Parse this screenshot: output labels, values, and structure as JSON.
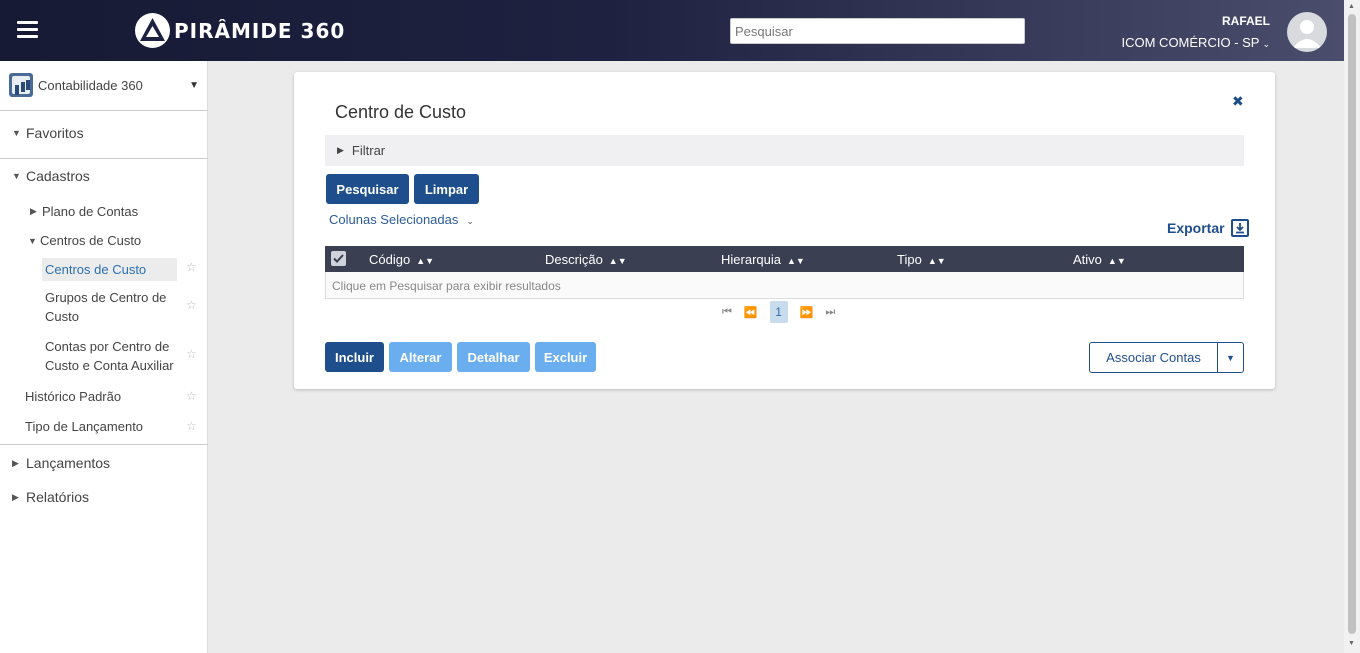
{
  "header": {
    "brand": "PIRÂMIDE 360",
    "search_placeholder": "Pesquisar",
    "user_name": "RAFAEL",
    "company": "ICOM COMÉRCIO - SP"
  },
  "sidebar": {
    "module": "Contabilidade 360",
    "favoritos": "Favoritos",
    "cadastros": "Cadastros",
    "plano_contas": "Plano de Contas",
    "centros_custo_group": "Centros de Custo",
    "centros_custo": "Centros de Custo",
    "grupos_centro_line1": "Grupos de Centro de",
    "grupos_centro_line2": "Custo",
    "contas_por_line1": "Contas por Centro de",
    "contas_por_line2": "Custo e Conta Auxiliar",
    "historico": "Histórico Padrão",
    "tipo_lancamento": "Tipo de Lançamento",
    "lancamentos": "Lançamentos",
    "relatorios": "Relatórios"
  },
  "main": {
    "title": "Centro de Custo",
    "filter": "Filtrar",
    "search_button": "Pesquisar",
    "clear_button": "Limpar",
    "selected_columns": "Colunas Selecionadas",
    "export": "Exportar",
    "columns": [
      "Código",
      "Descrição",
      "Hierarquia",
      "Tipo",
      "Ativo"
    ],
    "empty_message": "Clique em Pesquisar para exibir resultados",
    "current_page": "1",
    "include": "Incluir",
    "edit": "Alterar",
    "detail": "Detalhar",
    "delete": "Excluir",
    "associate": "Associar Contas"
  },
  "colors": {
    "primary": "#1f4e8c",
    "disabled": "#6aaef0",
    "header_dark": "#1e2240",
    "active_link": "#2c6fb1"
  }
}
